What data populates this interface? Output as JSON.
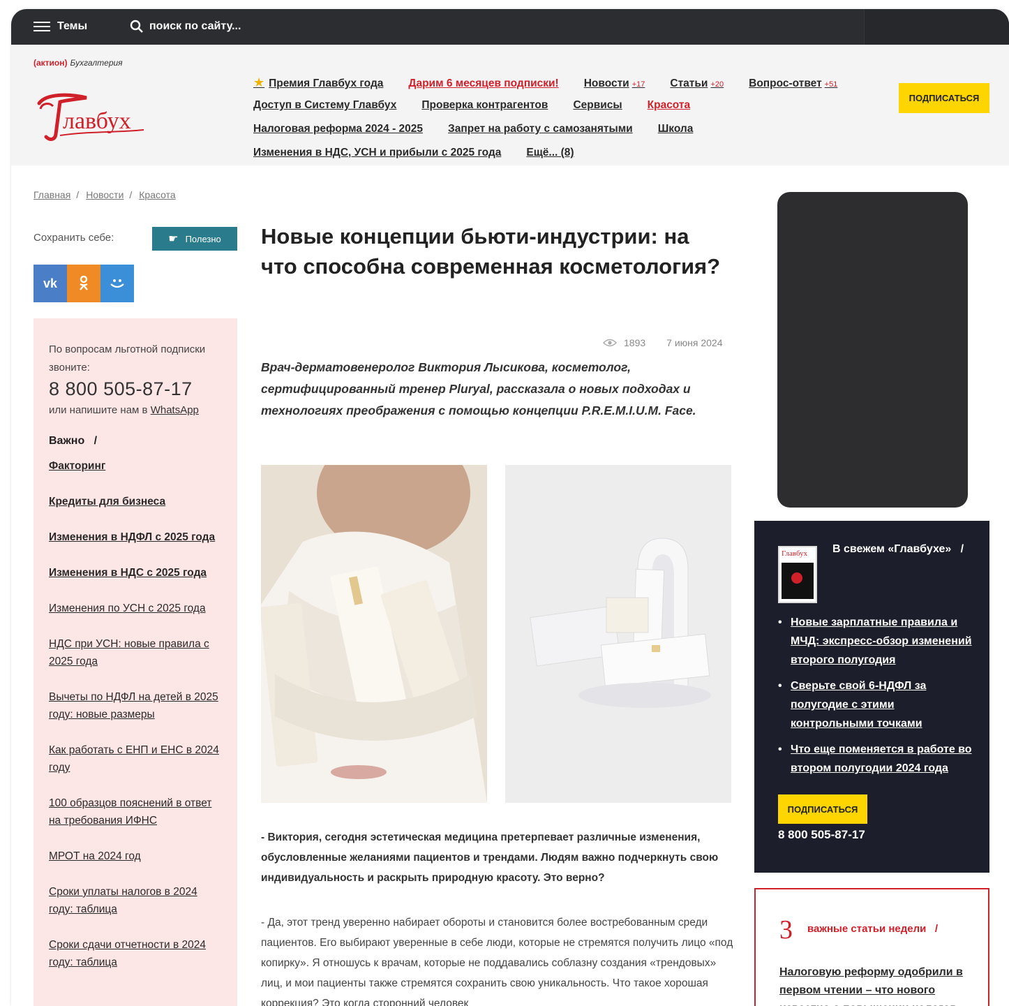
{
  "topbar": {
    "menu_label": "Темы",
    "search_placeholder": "поиск по сайту..."
  },
  "brand": {
    "aktion": "(актион)",
    "section": "Бухгалтерия",
    "logo": "Главбух"
  },
  "nav": {
    "row1": [
      {
        "label": "Премия Главбух года",
        "star": true
      },
      {
        "label": "Дарим 6 месяцев подписки!",
        "red": true
      },
      {
        "label": "Новости",
        "badge": "+17"
      },
      {
        "label": "Статьи",
        "badge": "+20"
      },
      {
        "label": "Вопрос-ответ",
        "badge": "+51"
      }
    ],
    "row2": [
      {
        "label": "Доступ в Систему Главбух"
      },
      {
        "label": "Проверка контрагентов"
      },
      {
        "label": "Сервисы"
      },
      {
        "label": "Красота",
        "red": true
      }
    ],
    "row3": [
      {
        "label": "Налоговая реформа 2024 - 2025"
      },
      {
        "label": "Запрет на работу с самозанятыми"
      },
      {
        "label": "Школа"
      }
    ],
    "row4": [
      {
        "label": "Изменения в НДС, УСН и прибыли с 2025 года"
      },
      {
        "label": "Ещё... (8)"
      }
    ],
    "subscribe": "ПОДПИСАТЬСЯ"
  },
  "breadcrumbs": [
    "Главная",
    "Новости",
    "Красота"
  ],
  "left": {
    "save_label": "Сохранить себе:",
    "useful_label": "Полезно",
    "share": [
      "VK",
      "OK",
      "MM"
    ],
    "subscription_text": "По вопросам льготной подписки звоните:",
    "phone": "8 800 505-87-17",
    "write_text": "или напишите нам в",
    "whatsapp": "WhatsApp",
    "important": "Важно",
    "links": [
      {
        "label": "Факторинг",
        "bold": true
      },
      {
        "label": "Кредиты для бизнеса",
        "bold": true
      },
      {
        "label": "Изменения в НДФЛ с 2025 года",
        "bold": true
      },
      {
        "label": "Изменения в НДС с 2025 года",
        "bold": true
      },
      {
        "label": "Изменения по УСН с 2025 года"
      },
      {
        "label": "НДС при УСН: новые правила с 2025 года"
      },
      {
        "label": "Вычеты по НДФЛ на детей в 2025 году: новые размеры"
      },
      {
        "label": "Как работать с ЕНП и ЕНС в 2024 году"
      },
      {
        "label": "100 образцов пояснений в ответ на требования ИФНС"
      },
      {
        "label": "МРОТ на 2024 год"
      },
      {
        "label": "Сроки уплаты налогов в 2024 году: таблица"
      },
      {
        "label": "Сроки сдачи отчетности в 2024 году: таблица"
      }
    ]
  },
  "article": {
    "title": "Новые концепции бьюти-индустрии: на что способна современная косметология?",
    "views": "1893",
    "date": "7 июня 2024",
    "lead": "Врач-дерматовенеролог Виктория Лысикова, косметолог, сертифицированный тренер Pluryal, рассказала о новых подходах и технологиях преображения с помощью концепции P.R.E.M.I.U.M. Face.",
    "question": "- Виктория, сегодня эстетическая медицина претерпевает различные изменения, обусловленные желаниями пациентов и трендами. Людям важно подчеркнуть свою индивидуальность и раскрыть природную красоту. Это верно?",
    "answer": "- Да, этот тренд уверенно набирает обороты и становится более востребованным среди пациентов. Его выбирают уверенные в себе люди, которые не стремятся получить лицо «под копирку». Я отношусь к врачам, которые не поддавались соблазну создания «трендовых» лиц, и мои пациенты также стремятся сохранить свою уникальность. Что такое хорошая коррекция? Это когда сторонний человек"
  },
  "right": {
    "fresh_title": "В свежем «Главбухе»",
    "fresh_items": [
      "Новые зарплатные правила и МЧД: экспресс-обзор изменений второго полугодия",
      "Сверьте свой 6-НДФЛ за полугодие с этими контрольными точками",
      "Что еще поменяется в работе во втором полугодии 2024 года"
    ],
    "subscribe": "ПОДПИСАТЬСЯ",
    "phone": "8 800 505-87-17",
    "week_num": "3",
    "week_title": "важные статьи недели",
    "week_link": "Налоговую реформу одобрили в первом чтении – что нового известно о повышении налогов"
  },
  "colors": {
    "accent_red": "#d0202a",
    "yellow": "#ffd500",
    "dark": "#2b2d31",
    "teal": "#2a7b8c",
    "pink": "#fde6e6"
  }
}
